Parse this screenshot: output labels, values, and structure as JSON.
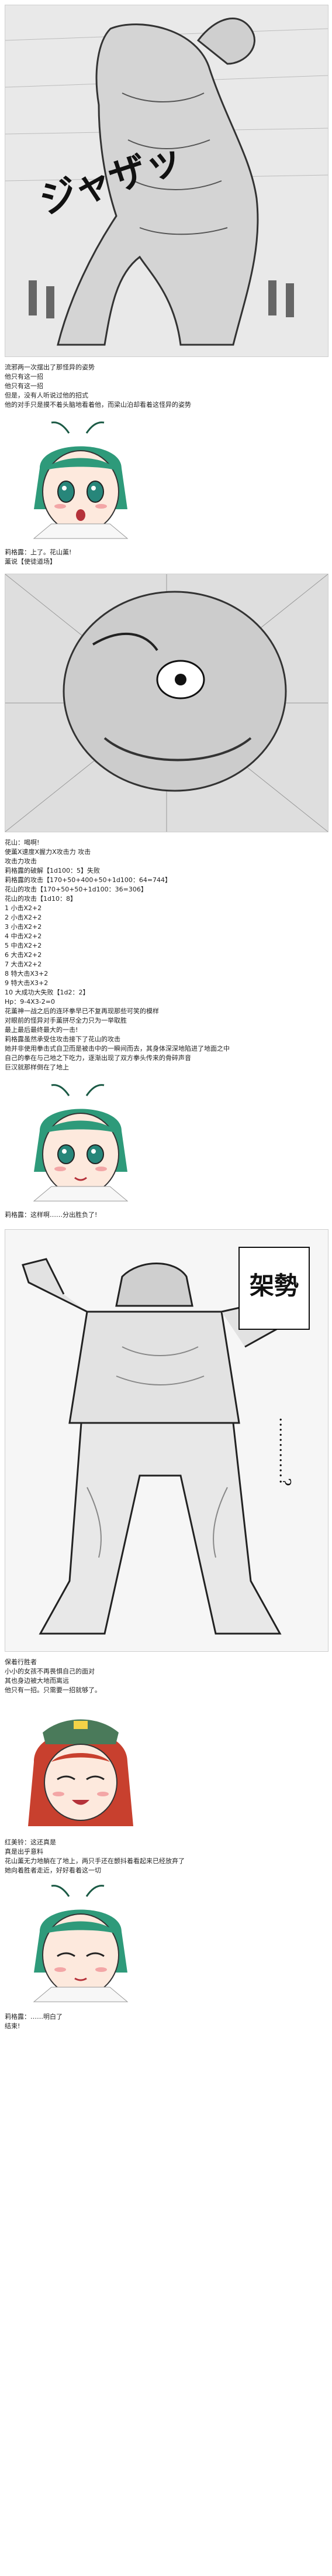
{
  "story": {
    "block1": [
      "流邪两一次摆出了那怪异的姿势",
      "他只有这一招",
      "他只有这一招",
      "但是，没有人听说过他的招式",
      "他的对手只是摸不着头脑地看着他，而梁山泊却看着这怪异的姿势"
    ],
    "dialog1": [
      "莉格露：上了。花山薫!",
      "薫说【使徒道场】"
    ],
    "block2": [
      "花山：喝啊!",
      "使薫X速度X握力X攻击力 攻击",
      "攻击力攻击",
      "莉格露的破解【1d100：5】失败",
      "莉格露的攻击【170+50+400+50+1d100：64=744】",
      "花山的攻击【170+50+50+1d100：36=306】",
      "花山的攻击【1d10：8】",
      "1 小击X2+2",
      "2 小击X2+2",
      "3 小击X2+2",
      "4 中击X2+2",
      "5 中击X2+2",
      "6 大击X2+2",
      "7 大击X2+2",
      "8 特大击X3+2",
      "9 特大击X3+2",
      "10 大成功大失败【1d2：2】",
      "Hp：9-4X3-2=0",
      "花薫神一战之后的连环拳早已不复再现那些可笑的模样",
      "对眼前的怪异对手薫拼尽全力只为一举取胜",
      "最上最后最终最大的一击!",
      "莉格露虽然承受住攻击接下了花山的攻击",
      "她并非使用拳击式自卫而是被击中的一瞬间而去，其身体深深地陷进了地面之中"
    ],
    "block3": [
      "自己的拳在与己地之下吃力，逐渐出现了双方拳头传来的骨碎声音",
      "巨汉就那样倒在了地上"
    ],
    "dialog2": [
      "莉格露：这样啊……分出胜负了!"
    ],
    "block4": [
      "保着行胜者",
      "小小的女孩不再畏惧自己的面对",
      "其也身边被大地而离远",
      "他只有一招。只需要一招就够了。"
    ],
    "dialog3": [
      "红美铃：这还真是",
      "真是出乎意料",
      "花山薫无力地躺在了地上，两只手还在颤抖着看起来已经放弃了",
      "她向着胜者走近，好好看着这一切"
    ],
    "dialog4": [
      "莉格露：……明白了",
      "结束!"
    ]
  },
  "sfx": {
    "katakana_hit": "ジャザッ",
    "kamae_title": "架勢",
    "question_dots": "…………?"
  },
  "colors": {
    "hair_green": "#2e9a7a",
    "hair_red": "#c8402e",
    "blush": "#f3a6a6",
    "eye": "#27867a"
  }
}
